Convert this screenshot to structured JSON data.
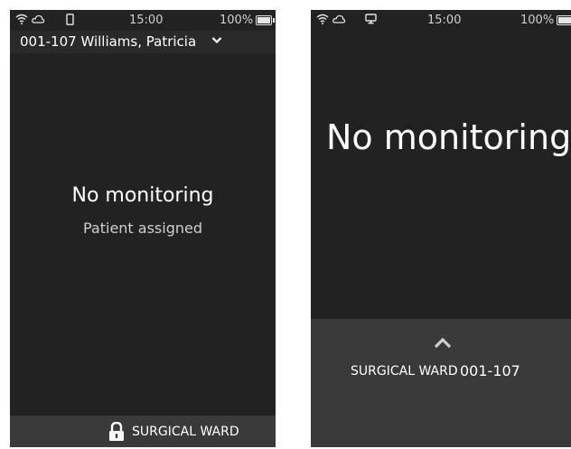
{
  "left_device": {
    "status": {
      "icons": [
        "wifi-icon",
        "cloud-icon",
        "phone-icon"
      ],
      "time": "15:00",
      "battery_text": "100%"
    },
    "patient_selector": {
      "label": "001-107  Williams, Patricia",
      "icon": "chevron-down-icon"
    },
    "main": {
      "title": "No monitoring",
      "subtitle": "Patient assigned"
    },
    "footer": {
      "icon": "lock-icon",
      "ward": "SURGICAL WARD"
    }
  },
  "right_device": {
    "status": {
      "icons": [
        "wifi-icon",
        "cloud-icon",
        "monitor-icon"
      ],
      "time": "15:00",
      "battery_text": "100%"
    },
    "main": {
      "title": "No monitoring"
    },
    "footer": {
      "icon": "chevron-up-icon",
      "ward": "SURGICAL WARD",
      "bed": "001-107"
    }
  },
  "colors": {
    "screen_bg": "#222222",
    "footer_bg": "#3a3a3a",
    "text": "#ffffff"
  }
}
